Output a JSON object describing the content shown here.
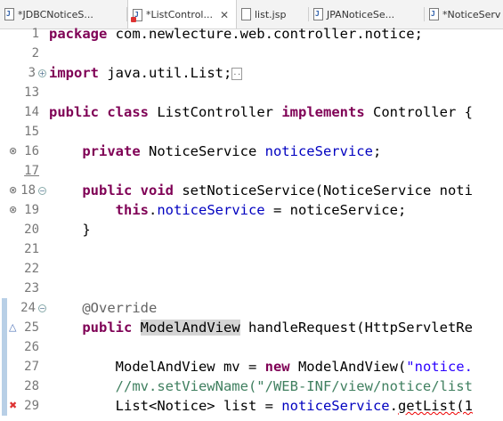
{
  "tabs": [
    {
      "label": "*JDBCNoticeS...",
      "active": false
    },
    {
      "label": "*ListControl...",
      "active": true
    },
    {
      "label": "list.jsp",
      "active": false
    },
    {
      "label": "JPANoticeSe...",
      "active": false
    },
    {
      "label": "*NoticeServ",
      "active": false
    }
  ],
  "editor": {
    "line_numbers": [
      "1",
      "2",
      "3",
      "13",
      "14",
      "15",
      "16",
      "17",
      "18",
      "19",
      "20",
      "21",
      "22",
      "23",
      "24",
      "25",
      "26",
      "27",
      "28",
      "29"
    ],
    "code": {
      "l1_kw": "package",
      "l1_rest": " com.newlecture.web.controller.notice;",
      "l3_kw": "import",
      "l3_rest": " java.util.List;",
      "l3_fold": "..",
      "l14_kw1": "public",
      "l14_kw2": "class",
      "l14_name": " ListController ",
      "l14_kw3": "implements",
      "l14_rest": " Controller {",
      "l16_kw": "private",
      "l16_type": " NoticeService ",
      "l16_fld": "noticeService",
      "l16_end": ";",
      "l18_kw1": "public",
      "l18_kw2": "void",
      "l18_rest": " setNoticeService(NoticeService noti",
      "l19_kw": "this",
      "l19_dot": ".",
      "l19_fld": "noticeService",
      "l19_rest": " = noticeService;",
      "l20_brace": "}",
      "l24_ann": "@Override",
      "l25_kw": "public",
      "l25_hl": "ModelAndView",
      "l25_rest": " handleRequest(HttpServletRe",
      "l27_a": "ModelAndView mv = ",
      "l27_kw": "new",
      "l27_b": " ModelAndView(",
      "l27_str": "\"notice.",
      "l28_cmt": "//mv.setViewName(\"/WEB-INF/view/notice/list",
      "l29_a": "List<Notice> list = ",
      "l29_fld": "noticeService",
      "l29_b": ".",
      "l29_err": "getList(1"
    }
  }
}
